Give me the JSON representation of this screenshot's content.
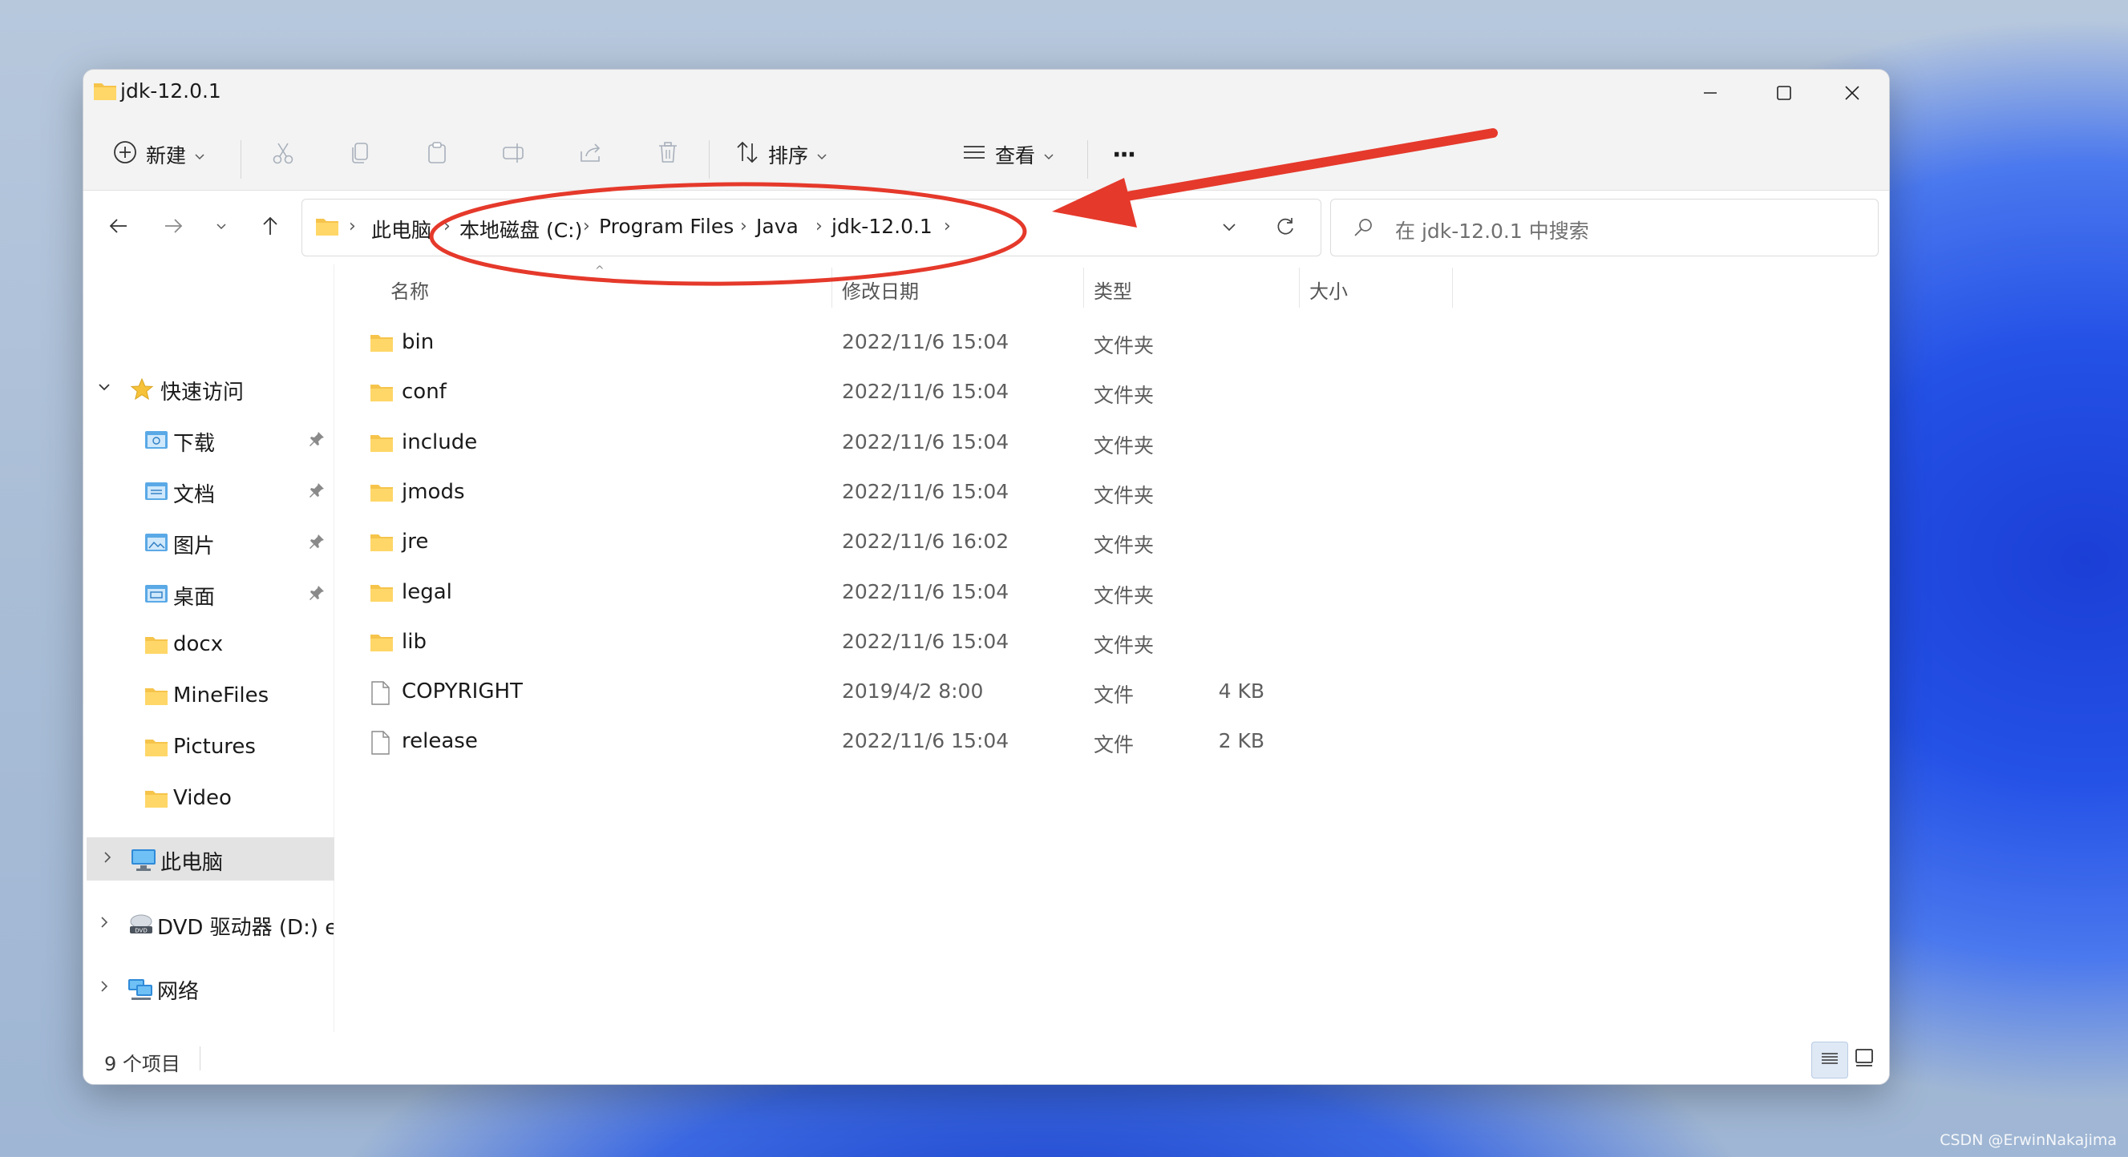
{
  "window": {
    "title": "jdk-12.0.1",
    "controls": {
      "minimize": "minimize",
      "maximize": "maximize",
      "close": "close"
    }
  },
  "toolbar": {
    "new_label": "新建",
    "sort_label": "排序",
    "view_label": "查看",
    "more_label": "···"
  },
  "navigation": {
    "breadcrumbs": [
      "此电脑",
      "本地磁盘 (C:)",
      "Program Files",
      "Java",
      "jdk-12.0.1"
    ],
    "search_placeholder": "在 jdk-12.0.1 中搜索"
  },
  "sidebar": {
    "quick_access": "快速访问",
    "items": [
      {
        "label": "下载",
        "icon": "download-folder-icon",
        "pinned": true
      },
      {
        "label": "文档",
        "icon": "documents-folder-icon",
        "pinned": true
      },
      {
        "label": "图片",
        "icon": "pictures-folder-icon",
        "pinned": true
      },
      {
        "label": "桌面",
        "icon": "desktop-folder-icon",
        "pinned": true
      },
      {
        "label": "docx",
        "icon": "folder-icon",
        "pinned": false
      },
      {
        "label": "MineFiles",
        "icon": "folder-icon",
        "pinned": false
      },
      {
        "label": "Pictures",
        "icon": "folder-icon",
        "pinned": false
      },
      {
        "label": "Video",
        "icon": "folder-icon",
        "pinned": false
      }
    ],
    "this_pc": "此电脑",
    "dvd_drive": "DVD 驱动器 (D:) esd",
    "network": "网络"
  },
  "columns": {
    "name": "名称",
    "modified": "修改日期",
    "type": "类型",
    "size": "大小"
  },
  "files": [
    {
      "name": "bin",
      "modified": "2022/11/6 15:04",
      "type": "文件夹",
      "size": "",
      "kind": "folder"
    },
    {
      "name": "conf",
      "modified": "2022/11/6 15:04",
      "type": "文件夹",
      "size": "",
      "kind": "folder"
    },
    {
      "name": "include",
      "modified": "2022/11/6 15:04",
      "type": "文件夹",
      "size": "",
      "kind": "folder"
    },
    {
      "name": "jmods",
      "modified": "2022/11/6 15:04",
      "type": "文件夹",
      "size": "",
      "kind": "folder"
    },
    {
      "name": "jre",
      "modified": "2022/11/6 16:02",
      "type": "文件夹",
      "size": "",
      "kind": "folder"
    },
    {
      "name": "legal",
      "modified": "2022/11/6 15:04",
      "type": "文件夹",
      "size": "",
      "kind": "folder"
    },
    {
      "name": "lib",
      "modified": "2022/11/6 15:04",
      "type": "文件夹",
      "size": "",
      "kind": "folder"
    },
    {
      "name": "COPYRIGHT",
      "modified": "2019/4/2 8:00",
      "type": "文件",
      "size": "4 KB",
      "kind": "file"
    },
    {
      "name": "release",
      "modified": "2022/11/6 15:04",
      "type": "文件",
      "size": "2 KB",
      "kind": "file"
    }
  ],
  "status": {
    "item_count": "9 个项目"
  },
  "watermark": "CSDN @ErwinNakajima",
  "colors": {
    "annotation": "#e5392b",
    "folder": "#f6c44b",
    "selection": "#e3e3e3"
  }
}
